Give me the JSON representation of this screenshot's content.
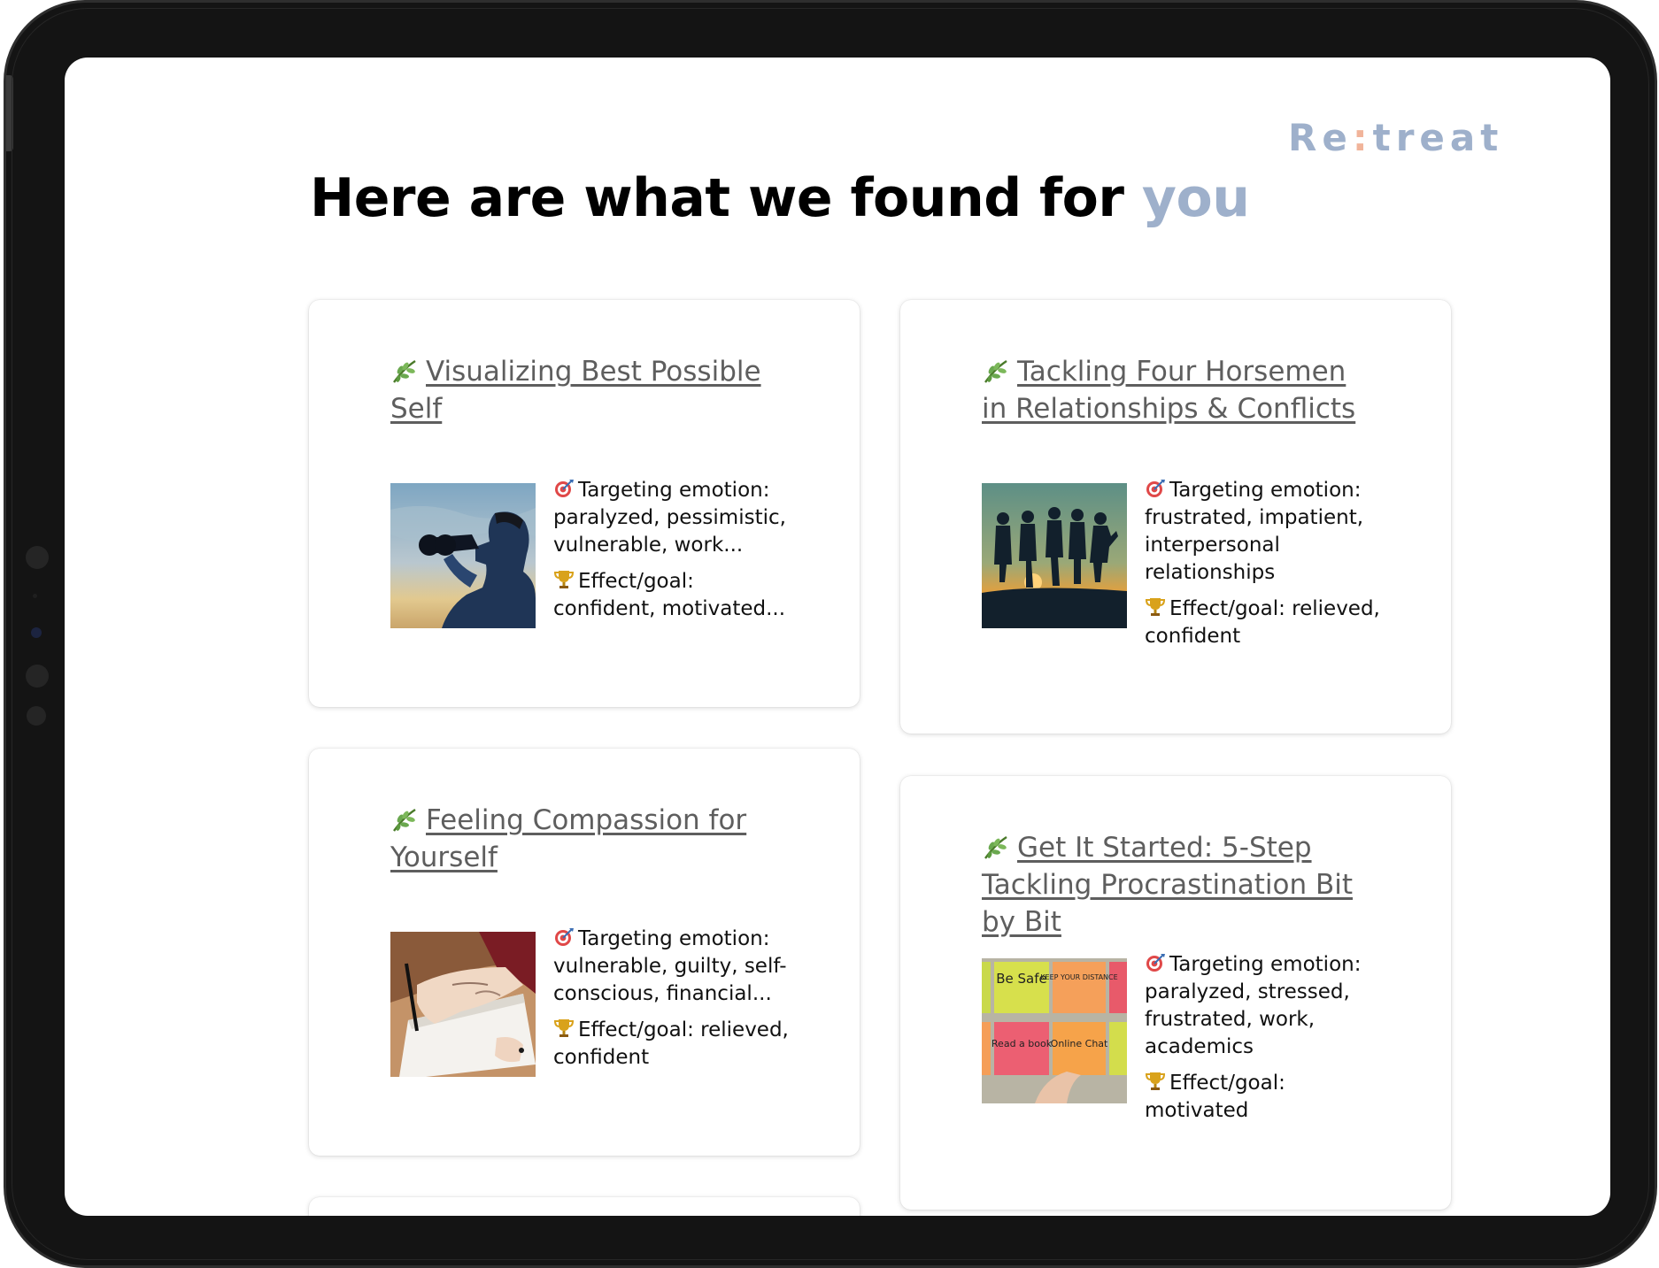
{
  "brand": {
    "prefix": "Re",
    "mid": ":",
    "suffix": "treat"
  },
  "headline": {
    "main": "Here are what we found for ",
    "accent": "you"
  },
  "colors": {
    "accent": "#9eb0cb",
    "brand_dot": "#f1b49a",
    "title_link": "#5e5e5e"
  },
  "cards": [
    {
      "title": "Visualizing Best Possible Self",
      "title_icon": "leaf-icon",
      "image": "person-binoculars-photo",
      "targeting_emotion": "Targeting emotion: paralyzed, pessimistic, vulnerable, work...",
      "effect_goal": "Effect/goal: confident, motivated..."
    },
    {
      "title": "Tackling Four Horsemen in Relationships & Conflicts",
      "title_icon": "leaf-icon",
      "image": "group-silhouette-sunset-photo",
      "targeting_emotion": "Targeting emotion: frustrated, impatient, interpersonal relationships",
      "effect_goal": "Effect/goal: relieved, confident"
    },
    {
      "title": "Feeling Compassion for Yourself",
      "title_icon": "leaf-icon",
      "image": "hand-writing-notebook-photo",
      "targeting_emotion": "Targeting emotion: vulnerable, guilty, self-conscious, financial...",
      "effect_goal": "Effect/goal: relieved, confident"
    },
    {
      "title": "Get It Started: 5-Step Tackling Procrastination Bit by Bit",
      "title_icon": "leaf-icon",
      "image": "sticky-notes-photo",
      "targeting_emotion": "Targeting emotion: paralyzed, stressed, frustrated, work, academics",
      "effect_goal": "Effect/goal: motivated",
      "sticky_notes": [
        "Be Safe",
        "KEEP YOUR DISTANCE",
        "Read a book",
        "Online Chat"
      ]
    }
  ]
}
